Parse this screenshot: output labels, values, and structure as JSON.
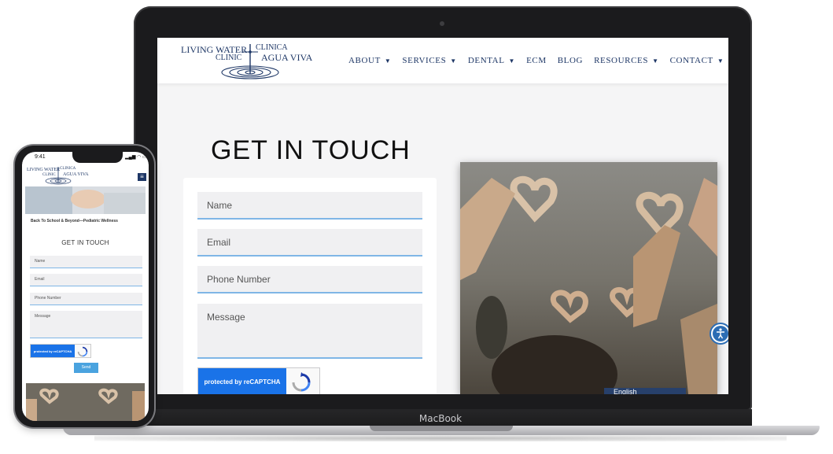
{
  "device": {
    "laptop_brand": "MacBook",
    "phone_time": "9:41"
  },
  "colors": {
    "navy": "#1e3766",
    "field_underline": "#7fb6e6",
    "recaptcha_blue": "#1a73e8",
    "send_button": "#4aa3df"
  },
  "logo": {
    "line1": "LIVING WATER",
    "line2": "CLINICA",
    "line3": "CLINIC",
    "line4": "AGUA VIVA"
  },
  "nav": [
    {
      "label": "ABOUT",
      "has_dropdown": true
    },
    {
      "label": "SERVICES",
      "has_dropdown": true
    },
    {
      "label": "DENTAL",
      "has_dropdown": true
    },
    {
      "label": "ECM",
      "has_dropdown": false
    },
    {
      "label": "BLOG",
      "has_dropdown": false
    },
    {
      "label": "RESOURCES",
      "has_dropdown": true
    },
    {
      "label": "CONTACT",
      "has_dropdown": true
    }
  ],
  "contact": {
    "heading": "GET IN TOUCH",
    "name_placeholder": "Name",
    "email_placeholder": "Email",
    "phone_placeholder": "Phone Number",
    "message_placeholder": "Message",
    "recaptcha_label": "protected by reCAPTCHA"
  },
  "language": {
    "label": "English"
  },
  "mobile": {
    "banner_caption": "Back To School & Beyond—Pediatric Wellness",
    "heading": "GET IN TOUCH",
    "name_placeholder": "Name",
    "email_placeholder": "Email",
    "phone_placeholder": "Phone Number",
    "message_placeholder": "Message",
    "recaptcha_label": "protected by reCAPTCHA",
    "send_label": "Send"
  }
}
